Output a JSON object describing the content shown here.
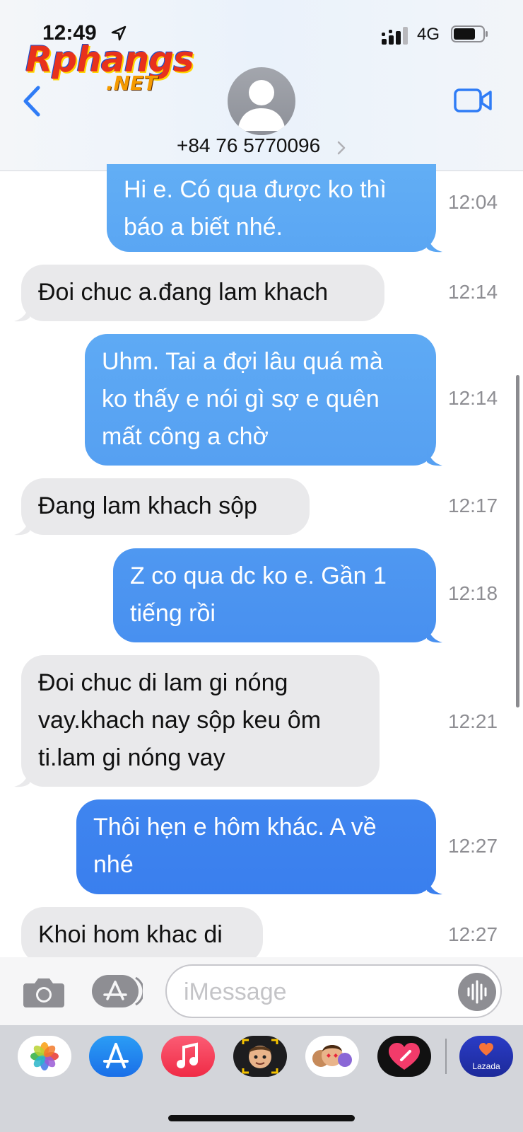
{
  "status": {
    "time": "12:49",
    "network": "4G"
  },
  "watermark": {
    "main": "Rphangs",
    "sub": ".NET"
  },
  "contact": {
    "number": "+84 76 5770096"
  },
  "messages": [
    {
      "dir": "sent",
      "text": "Hi e. Có qua được ko thì báo a biết nhé.",
      "lines": [
        "Hi e. Có qua được ko thì",
        "báo a biết nhé."
      ],
      "time": "12:04"
    },
    {
      "dir": "recv",
      "text": "Đoi chuc a.đang lam khach",
      "lines": [
        "Đoi chuc a.đang lam khach"
      ],
      "time": "12:14"
    },
    {
      "dir": "sent",
      "text": "Uhm. Tai a đợi lâu quá mà ko thấy e nói gì sợ e quên mất công a chờ",
      "lines": [
        "Uhm. Tai a đợi lâu quá mà",
        "ko thấy e nói gì sợ e quên",
        "mất công a chờ"
      ],
      "time": "12:14"
    },
    {
      "dir": "recv",
      "text": "Đang lam khach sộp",
      "lines": [
        "Đang lam khach sộp"
      ],
      "time": "12:17"
    },
    {
      "dir": "sent",
      "text": "Z co qua dc ko e. Gần 1 tiếng rồi",
      "lines": [
        "Z co qua dc ko e. Gần 1",
        "tiếng rồi"
      ],
      "time": "12:18"
    },
    {
      "dir": "recv",
      "text": "Đoi chuc di lam gi nóng vay.khach nay sộp keu ôm ti.lam gi nóng vay",
      "lines": [
        "Đoi chuc di lam gi nóng",
        "vay.khach nay sộp keu ôm",
        "ti.lam gi nóng vay"
      ],
      "time": "12:21"
    },
    {
      "dir": "sent",
      "text": "Thôi hẹn e hôm khác. A về nhé",
      "lines": [
        "Thôi hẹn e hôm khác. A về",
        "nhé"
      ],
      "time": "12:27"
    },
    {
      "dir": "recv",
      "text": "Khoi hom khac di",
      "lines": [
        "Khoi hom khac di"
      ],
      "time": "12:27"
    }
  ],
  "input": {
    "placeholder": "iMessage"
  },
  "drawer": {
    "apps": [
      {
        "icon": "photos-icon"
      },
      {
        "icon": "app-store-icon"
      },
      {
        "icon": "music-icon"
      },
      {
        "icon": "memoji-icon"
      },
      {
        "icon": "memoji-stickers-icon"
      },
      {
        "icon": "digital-touch-icon"
      },
      {
        "icon": "lazada-icon",
        "label": "Lazada"
      }
    ]
  },
  "colors": {
    "sent_top": "#5aa6f3",
    "sent_bottom": "#3a7fee",
    "received": "#e9e9eb",
    "ios_blue": "#2f7cf6"
  }
}
